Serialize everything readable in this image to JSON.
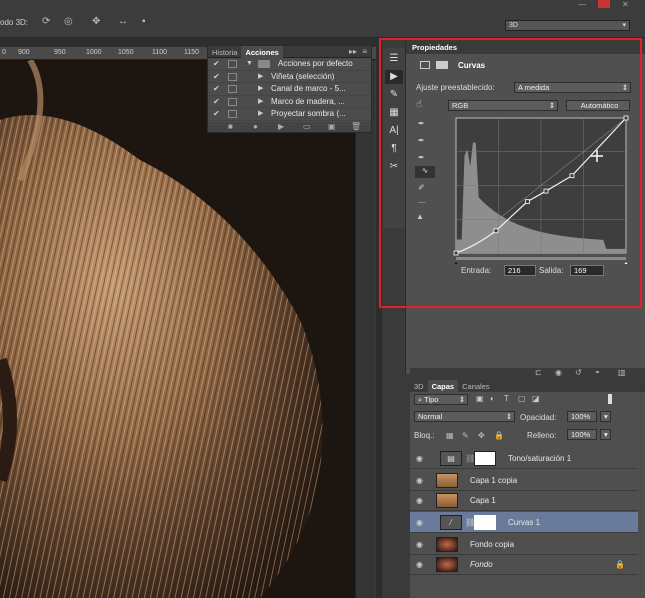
{
  "optionsbar": {
    "mode_label": "odo 3D:",
    "workspace": "3D"
  },
  "ruler": {
    "ticks": [
      "900",
      "950",
      "1000",
      "1050",
      "1100",
      "1150"
    ]
  },
  "history_panel": {
    "tabs": [
      "Historia",
      "Acciones"
    ],
    "rows": [
      {
        "label": "Acciones por defecto"
      },
      {
        "label": "Viñeta (selección)"
      },
      {
        "label": "Canal de marco - 5..."
      },
      {
        "label": "Marco de madera, ..."
      },
      {
        "label": "Proyectar sombra (..."
      }
    ]
  },
  "properties": {
    "title": "Propiedades",
    "adjustment": "Curvas",
    "preset_label": "Ajuste preestablecido:",
    "preset_value": "A medida",
    "channel": "RGB",
    "auto_button": "Automático",
    "input_label": "Entrada:",
    "input_value": "216",
    "output_label": "Salida:",
    "output_value": "169"
  },
  "curve_points": [
    [
      0,
      0
    ],
    [
      60,
      42
    ],
    [
      107,
      97
    ],
    [
      135,
      117
    ],
    [
      174,
      146
    ],
    [
      255,
      255
    ]
  ],
  "layers": {
    "tabs": [
      "3D",
      "Capas",
      "Canales"
    ],
    "filter": "Tipo",
    "blend": "Normal",
    "opacity_label": "Opacidad:",
    "opacity": "100%",
    "lock_label": "Bloq.:",
    "fill_label": "Relleno:",
    "fill": "100%",
    "items": [
      {
        "name": "Tono/saturación 1",
        "type": "adj"
      },
      {
        "name": "Capa 1 copia",
        "type": "img"
      },
      {
        "name": "Capa 1",
        "type": "img"
      },
      {
        "name": "Curvas 1",
        "type": "adj",
        "selected": true
      },
      {
        "name": "Fondo copia",
        "type": "photo"
      },
      {
        "name": "Fondo",
        "type": "photo"
      }
    ]
  },
  "colors": {
    "highlight": "#e0202a",
    "selected_row": "#6a7a9a"
  }
}
